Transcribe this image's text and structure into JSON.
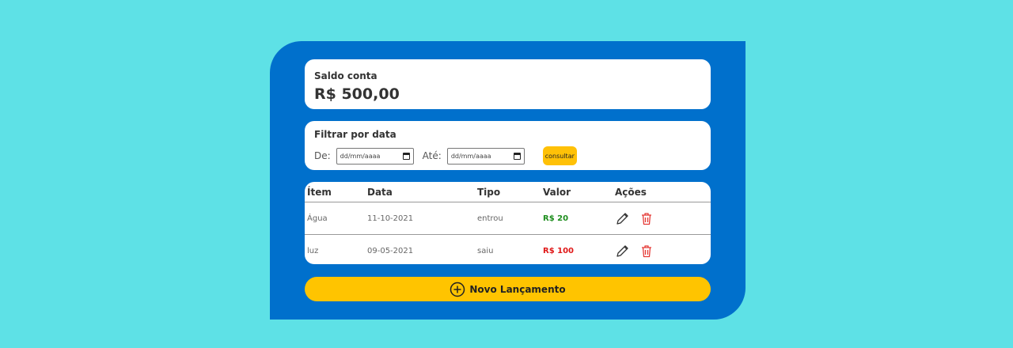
{
  "balance": {
    "label": "Saldo conta",
    "value": "R$ 500,00"
  },
  "filter": {
    "label": "Filtrar por data",
    "from_label": "De:",
    "to_label": "Até:",
    "from_placeholder": "dd/mm/aaaa",
    "to_placeholder": "dd/mm/aaaa",
    "button": "consultar"
  },
  "table": {
    "headers": {
      "item": "Ítem",
      "data": "Data",
      "tipo": "Tipo",
      "valor": "Valor",
      "acoes": "Ações"
    },
    "rows": [
      {
        "item": "Água",
        "data": "11-10-2021",
        "tipo": "entrou",
        "valor": "R$ 20"
      },
      {
        "item": "luz",
        "data": "09-05-2021",
        "tipo": "saiu",
        "valor": "R$ 100"
      }
    ]
  },
  "new_button": {
    "label": "Novo Lançamento"
  },
  "colors": {
    "background": "#5ee1e6",
    "panel": "#0070cc",
    "accent": "#ffc400",
    "income": "#1e8e1e",
    "expense": "#e01919"
  }
}
